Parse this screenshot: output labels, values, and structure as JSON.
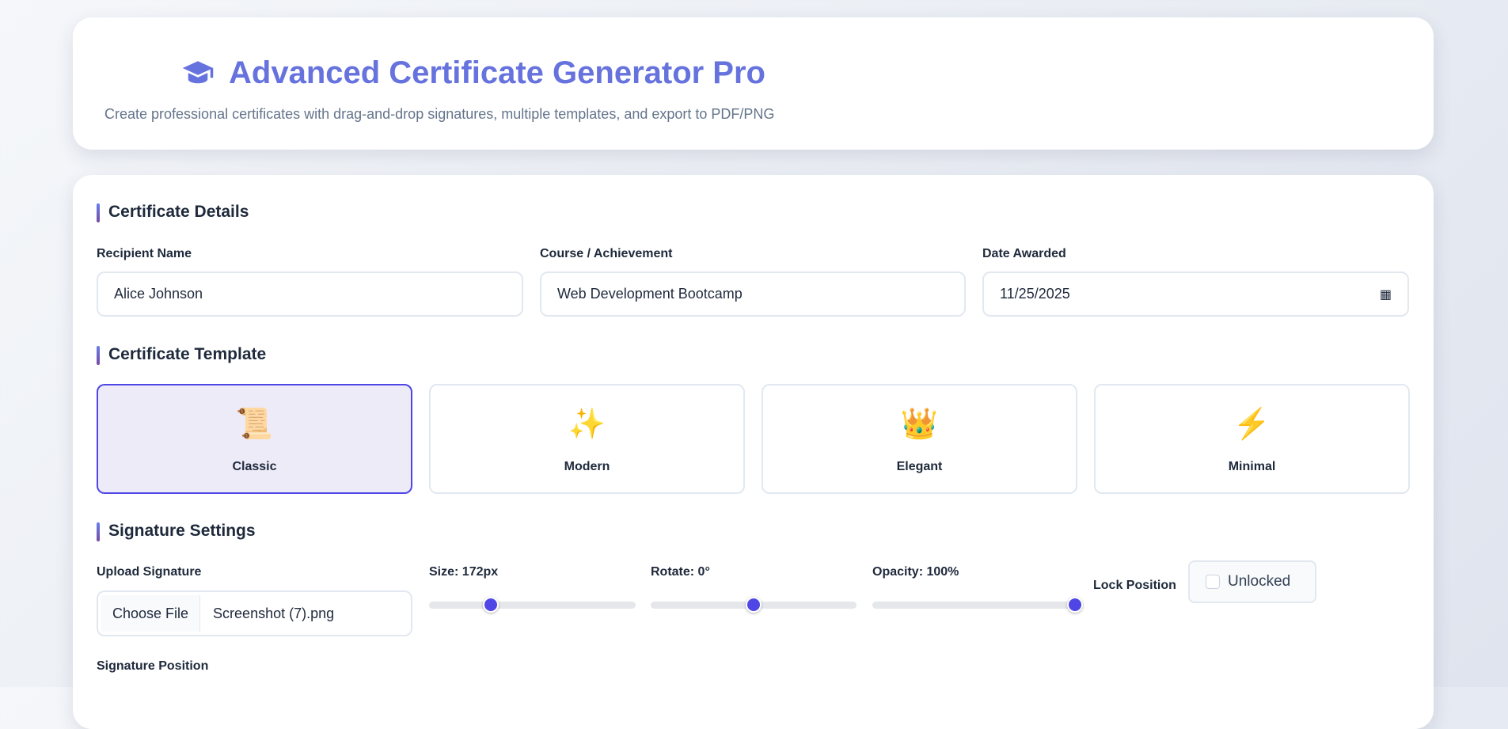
{
  "header": {
    "title": "Advanced Certificate Generator Pro",
    "subtitle": "Create professional certificates with drag-and-drop signatures, multiple templates, and export to PDF/PNG",
    "icon": "graduation-cap-icon"
  },
  "details": {
    "title": "Certificate Details",
    "recipient": {
      "label": "Recipient Name",
      "value": "Alice Johnson"
    },
    "course": {
      "label": "Course / Achievement",
      "value": "Web Development Bootcamp"
    },
    "date": {
      "label": "Date Awarded",
      "value": "11/25/2025"
    }
  },
  "templates": {
    "title": "Certificate Template",
    "selected": "Classic",
    "items": [
      {
        "name": "Classic",
        "icon": "📜"
      },
      {
        "name": "Modern",
        "icon": "✨"
      },
      {
        "name": "Elegant",
        "icon": "👑"
      },
      {
        "name": "Minimal",
        "icon": "⚡"
      }
    ]
  },
  "signature": {
    "title": "Signature Settings",
    "upload": {
      "label": "Upload Signature",
      "button": "Choose File",
      "file": "Screenshot (7).png"
    },
    "size": {
      "label": "Size: 172px",
      "fraction": 0.3
    },
    "rotate": {
      "label": "Rotate: 0°",
      "fraction": 0.5
    },
    "opacity": {
      "label": "Opacity: 100%",
      "fraction": 1.0
    },
    "lock": {
      "label": "Lock Position",
      "state": "Unlocked",
      "checked": false
    },
    "position_label": "Signature Position"
  },
  "colors": {
    "accent": "#4f46e5",
    "title": "#6672dd"
  }
}
